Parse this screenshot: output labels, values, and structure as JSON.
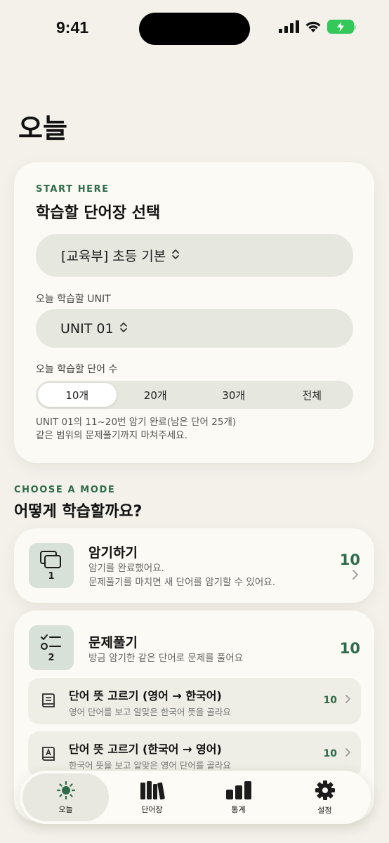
{
  "status": {
    "time": "9:41"
  },
  "page": {
    "title": "오늘"
  },
  "study": {
    "eyebrow": "START HERE",
    "heading": "학습할 단어장 선택",
    "book_selected": "[교육부] 초등 기본",
    "unit_label": "오늘 학습할 UNIT",
    "unit_selected": "UNIT 01",
    "count_label": "오늘 학습할 단어 수",
    "count_options": [
      "10개",
      "20개",
      "30개",
      "전체"
    ],
    "count_selected_index": 0,
    "hint_line1": "UNIT 01의 11~20번 암기 완료(남은 단어 25개)",
    "hint_line2": "같은 범위의 문제풀기까지 마쳐주세요."
  },
  "modes": {
    "eyebrow": "CHOOSE A MODE",
    "title": "어떻게 학습할까요?",
    "memorize": {
      "number": "1",
      "title": "암기하기",
      "sub1": "암기를 완료했어요.",
      "sub2": "문제풀기를 마치면 새 단어를 암기할 수 있어요.",
      "count": "10"
    },
    "quiz": {
      "number": "2",
      "title": "문제풀기",
      "sub": "방금 암기한 같은 단어로 문제를 풀어요",
      "count": "10",
      "items": [
        {
          "title": "단어 뜻 고르기 (영어 → 한국어)",
          "desc": "영어 단어를 보고 알맞은 한국어 뜻을 골라요",
          "count": "10"
        },
        {
          "title": "단어 뜻 고르기 (한국어 → 영어)",
          "desc": "한국어 뜻을 보고 알맞은 영어 단어를 골라요",
          "count": "10"
        }
      ]
    }
  },
  "tabs": [
    {
      "label": "오늘",
      "icon": "sun-icon",
      "active": true
    },
    {
      "label": "단어장",
      "icon": "books-icon",
      "active": false
    },
    {
      "label": "통계",
      "icon": "bar-chart-icon",
      "active": false
    },
    {
      "label": "설정",
      "icon": "gear-icon",
      "active": false
    }
  ],
  "colors": {
    "background": "#F3F1EA",
    "accent": "#2F6B4A",
    "card": "#FBFAF5"
  }
}
